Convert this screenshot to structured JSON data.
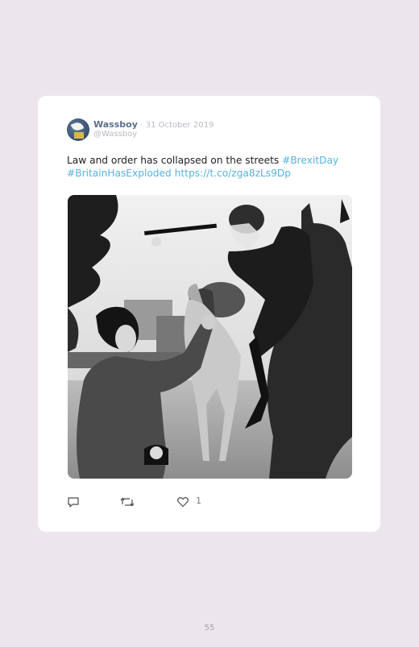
{
  "tweet": {
    "author_name": "Wassboy",
    "separator": "·",
    "date": "31 October 2019",
    "handle": "@Wassboy",
    "text_plain": "Law and order has collapsed on the streets ",
    "hashtag1": "#BrexitDay",
    "hashtag2": "#BritainHasExploded",
    "link": "https://t.co/zga8zLs9Dp",
    "photo_icon": "protest-photo",
    "actions": {
      "reply_icon": "reply-icon",
      "retweet_icon": "retweet-icon",
      "like_icon": "heart-icon",
      "like_count": "1"
    }
  },
  "page": {
    "number": "55"
  },
  "colors": {
    "background": "#ece6ec",
    "card": "#ffffff",
    "link": "#56b3e0",
    "name": "#5a6f8c"
  }
}
